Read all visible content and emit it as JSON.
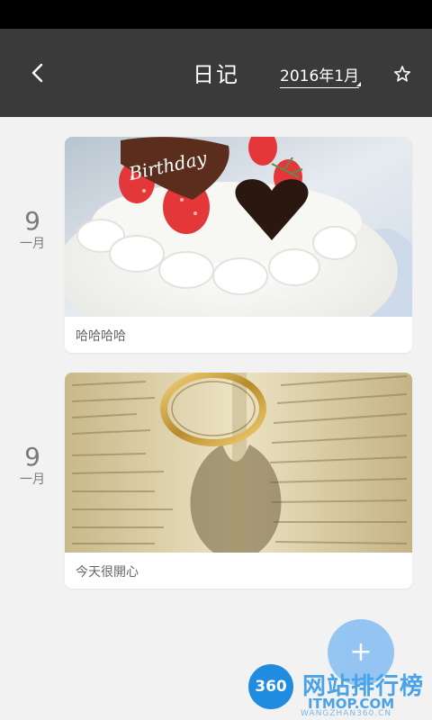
{
  "header": {
    "title": "日记",
    "month_label": "2016年1月",
    "back_icon": "chevron-left-icon",
    "star_icon": "star-outline-icon",
    "background": "#3a3a3a"
  },
  "entries": [
    {
      "day": "9",
      "month": "一月",
      "caption": "哈哈哈哈",
      "photo": "birthday-cake-photo"
    },
    {
      "day": "9",
      "month": "一月",
      "caption": "今天很開心",
      "photo": "ring-on-book-photo"
    }
  ],
  "fab": {
    "label": "+",
    "color": "#8dc2f2"
  },
  "watermark": {
    "badge": "360",
    "title": "网站排行榜",
    "logo": "ITMOP.COM",
    "url": "WANGZHAN360.CN"
  }
}
